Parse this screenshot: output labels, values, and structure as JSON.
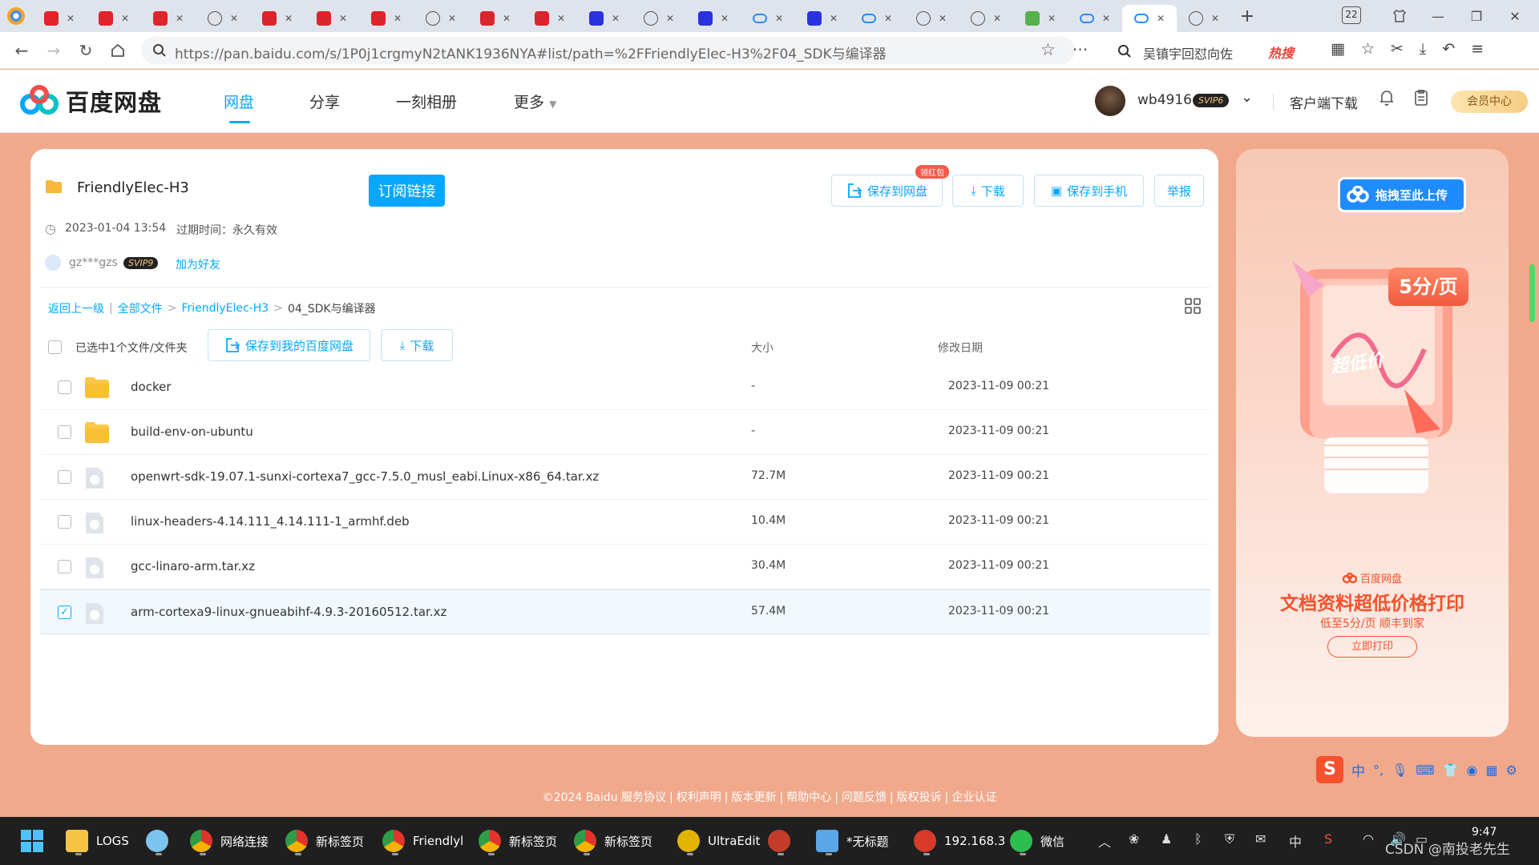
{
  "browser": {
    "tab_count": "22",
    "tabs": [
      {
        "icon": "baidu-red-icon"
      },
      {
        "icon": "baidu-red-icon"
      },
      {
        "icon": "baidu-red-icon"
      },
      {
        "icon": "globe-icon"
      },
      {
        "icon": "csdn-icon"
      },
      {
        "icon": "csdn-icon"
      },
      {
        "icon": "csdn-icon"
      },
      {
        "icon": "globe-icon"
      },
      {
        "icon": "csdn-icon"
      },
      {
        "icon": "csdn-icon"
      },
      {
        "icon": "baidu-paw-icon"
      },
      {
        "icon": "globe-icon"
      },
      {
        "icon": "baidu-paw-icon"
      },
      {
        "icon": "cloud-icon"
      },
      {
        "icon": "baidu-paw-icon"
      },
      {
        "icon": "cloud-icon"
      },
      {
        "icon": "globe-icon"
      },
      {
        "icon": "globe-icon"
      },
      {
        "icon": "android-icon"
      },
      {
        "icon": "netdisk-icon"
      },
      {
        "icon": "netdisk-icon",
        "active": true
      },
      {
        "icon": "globe-icon"
      }
    ],
    "url": "https://pan.baidu.com/s/1P0j1crgmyN2tANK1936NYA#list/path=%2FFriendlyElec-H3%2F04_SDK与编译器",
    "search_text": "吴镇宇回怼向佐",
    "hot_label": "热搜"
  },
  "site": {
    "brand": "百度网盘",
    "nav": [
      "网盘",
      "分享",
      "一刻相册",
      "更多"
    ],
    "username": "wb4916",
    "user_badge": "SVIP6",
    "client_download": "客户端下载",
    "member_center": "会员中心"
  },
  "share": {
    "folder_name": "FriendlyElec-H3",
    "subscribe": "订阅链接",
    "red_packet": "领红包",
    "save_to_disk": "保存到网盘",
    "download": "下载",
    "save_to_phone": "保存到手机",
    "report": "举报",
    "created": "2023-01-04 13:54",
    "expiry_label": "过期时间：永久有效",
    "sharer": "gz***gzs",
    "sharer_badge": "SVIP9",
    "add_friend": "加为好友"
  },
  "breadcrumb": {
    "back": "返回上一级",
    "all_files": "全部文件",
    "parent": "FriendlyElec-H3",
    "current": "04_SDK与编译器",
    "sep1": "|",
    "sep2": ">",
    "sep3": ">"
  },
  "list": {
    "selected_label": "已选中1个文件/文件夹",
    "save_to_baidu": "保存到我的百度网盘",
    "download": "下载",
    "col_size": "大小",
    "col_date": "修改日期",
    "rows": [
      {
        "name": "docker",
        "size": "-",
        "date": "2023-11-09 00:21",
        "kind": "folder",
        "checked": false
      },
      {
        "name": "build-env-on-ubuntu",
        "size": "-",
        "date": "2023-11-09 00:21",
        "kind": "folder",
        "checked": false
      },
      {
        "name": "openwrt-sdk-19.07.1-sunxi-cortexa7_gcc-7.5.0_musl_eabi.Linux-x86_64.tar.xz",
        "size": "72.7M",
        "date": "2023-11-09 00:21",
        "kind": "file",
        "checked": false
      },
      {
        "name": "linux-headers-4.14.111_4.14.111-1_armhf.deb",
        "size": "10.4M",
        "date": "2023-11-09 00:21",
        "kind": "file",
        "checked": false
      },
      {
        "name": "gcc-linaro-arm.tar.xz",
        "size": "30.4M",
        "date": "2023-11-09 00:21",
        "kind": "file",
        "checked": false
      },
      {
        "name": "arm-cortexa9-linux-gnueabihf-4.9.3-20160512.tar.xz",
        "size": "57.4M",
        "date": "2023-11-09 00:21",
        "kind": "file",
        "checked": true
      }
    ]
  },
  "ad": {
    "upload_btn": "拖拽至此上传",
    "price_tag": "5分/页",
    "low_price": "超低价",
    "brand": "百度网盘",
    "headline": "文档资料超低价格打印",
    "subline": "低至5分/页 顺丰到家",
    "cta": "立即打印"
  },
  "footer": {
    "copyright": "©2024 Baidu",
    "links": [
      "服务协议",
      "权利声明",
      "版本更新",
      "帮助中心",
      "问题反馈",
      "版权投诉",
      "企业认证"
    ],
    "sep": "|"
  },
  "ime": {
    "lang": "中"
  },
  "taskbar": {
    "items": [
      {
        "label": "LOGS",
        "icon": "folder-icon"
      },
      {
        "label": "",
        "icon": "paint-icon"
      },
      {
        "label": "网络连接",
        "icon": "browser-icon"
      },
      {
        "label": "新标签页",
        "icon": "browser-icon"
      },
      {
        "label": "Friendlyl",
        "icon": "browser-icon"
      },
      {
        "label": "新标签页",
        "icon": "browser-icon"
      },
      {
        "label": "新标签页",
        "icon": "browser-icon"
      },
      {
        "label": "UltraEdit",
        "icon": "ultraedit-icon"
      },
      {
        "label": "",
        "icon": "app-icon"
      },
      {
        "label": "*无标题",
        "icon": "notepad-icon"
      },
      {
        "label": "192.168.3",
        "icon": "shell-icon"
      },
      {
        "label": "微信",
        "icon": "wechat-icon"
      }
    ],
    "ime": "中",
    "time": "9:47",
    "watermark": "CSDN @南投老先生"
  },
  "colors": {
    "accent": "#06a7ff",
    "page_bg": "#f1a98c",
    "ad_red": "#f4512c"
  }
}
